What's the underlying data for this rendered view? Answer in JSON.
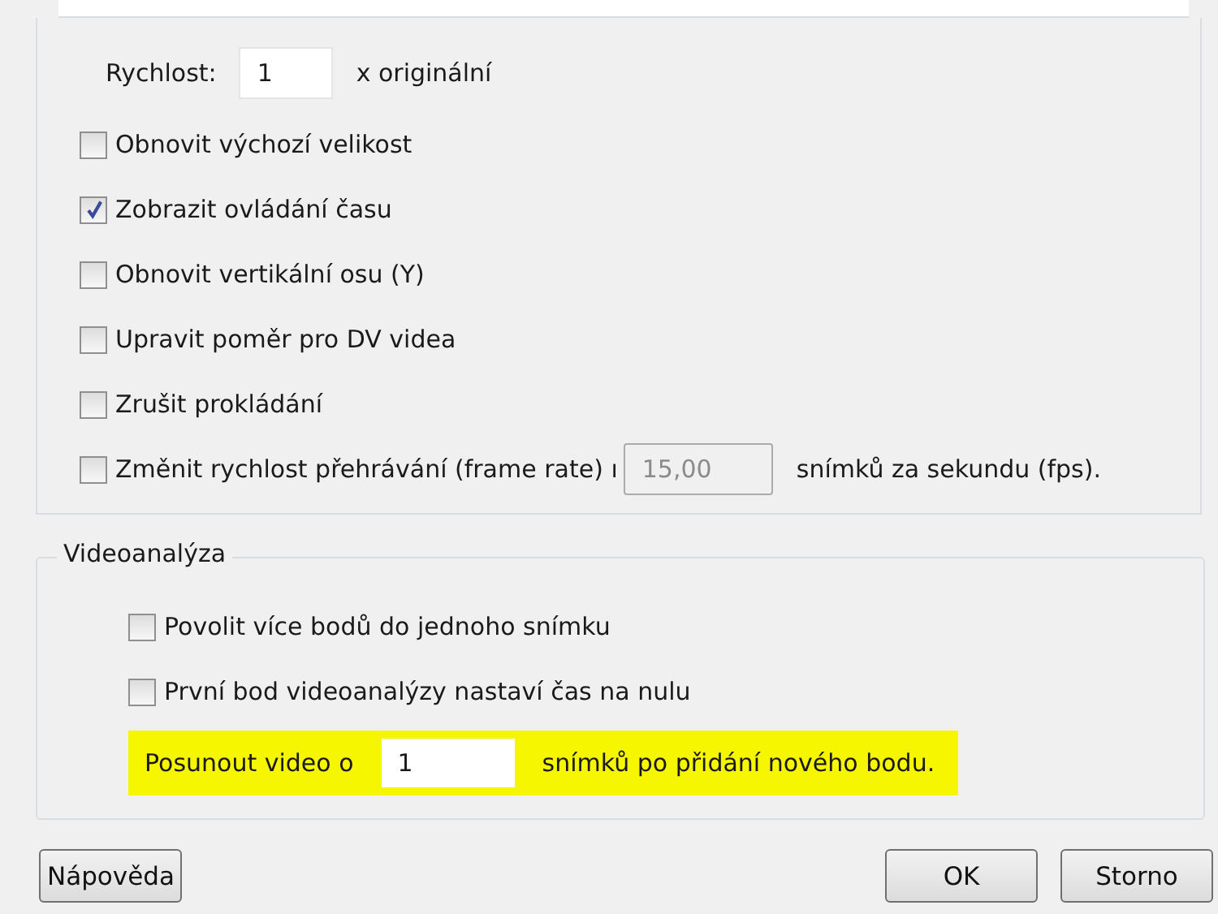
{
  "playback": {
    "speed": {
      "label": "Rychlost:",
      "value": "1",
      "suffix": "x originální"
    },
    "options": [
      {
        "kind": "checkbox",
        "label": "Obnovit výchozí velikost",
        "checked": false
      },
      {
        "kind": "checkbox",
        "label": "Zobrazit ovládání času",
        "checked": true
      },
      {
        "kind": "checkbox",
        "label": "Obnovit vertikální osu (Y)",
        "checked": false
      },
      {
        "kind": "checkbox",
        "label": "Upravit poměr pro DV videa",
        "checked": false
      },
      {
        "kind": "checkbox",
        "label": "Zrušit prokládání",
        "checked": false
      },
      {
        "kind": "checkbox_field",
        "label": "Změnit rychlost přehrávání (frame rate) ı",
        "checked": false,
        "value": "15,00",
        "disabled": true,
        "suffix": "snímků za sekundu (fps)."
      }
    ]
  },
  "videoanalysis": {
    "title": "Videoanalýza",
    "options": [
      {
        "label": "Povolit více bodů do jednoho snímku",
        "checked": false
      },
      {
        "label": "První bod videoanalýzy nastaví čas na nulu",
        "checked": false
      }
    ],
    "advance": {
      "label": "Posunout video o",
      "value": "1",
      "suffix": "snímků po přidání nového bodu.",
      "highlighted": true
    }
  },
  "buttons": {
    "help": "Nápověda",
    "ok": "OK",
    "cancel": "Storno"
  }
}
